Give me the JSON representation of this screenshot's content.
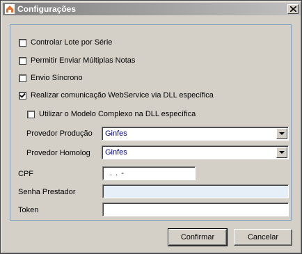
{
  "window": {
    "title": "Configurações"
  },
  "options": {
    "controlar_lote": {
      "label": "Controlar Lote por Série",
      "checked": false
    },
    "permitir_multiplas": {
      "label": "Permitir Enviar Múltiplas Notas",
      "checked": false
    },
    "envio_sincrono": {
      "label": "Envio Síncrono",
      "checked": false
    },
    "realizar_webservice": {
      "label": "Realizar comunicação WebService via DLL específica",
      "checked": true
    },
    "modelo_complexo": {
      "label": "Utilizar o Modelo Complexo na DLL específica",
      "checked": false
    }
  },
  "fields": {
    "provedor_producao": {
      "label": "Provedor Produção",
      "value": "Ginfes"
    },
    "provedor_homolog": {
      "label": "Provedor Homolog",
      "value": "Ginfes"
    },
    "cpf": {
      "label": "CPF",
      "value": " .  .  -"
    },
    "senha": {
      "label": "Senha Prestador",
      "value": ""
    },
    "token": {
      "label": "Token",
      "value": ""
    }
  },
  "buttons": {
    "confirmar": "Confirmar",
    "cancelar": "Cancelar"
  }
}
